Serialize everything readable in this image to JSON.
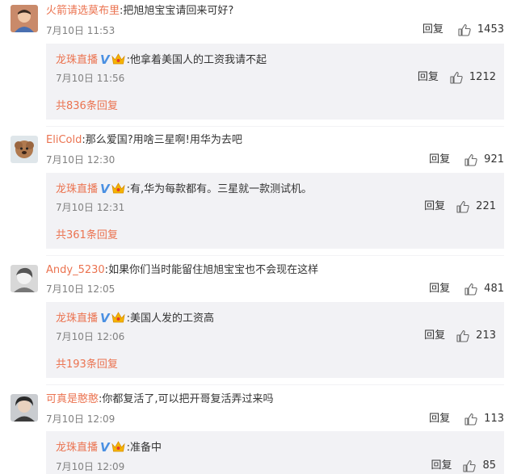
{
  "threads": [
    {
      "user": "火箭请选莫布里",
      "text": "把旭旭宝宝请回来可好?",
      "time": "7月10日 11:53",
      "reply_label": "回复",
      "likes": "1453",
      "sub": {
        "user": "龙珠直播",
        "text": "他拿着美国人的工资我请不起",
        "time": "7月10日 11:56",
        "reply_label": "回复",
        "likes": "1212",
        "total": "共836条回复"
      }
    },
    {
      "user": "EliCold",
      "text": "那么爱国?用啥三星啊!用华为去吧",
      "time": "7月10日 12:30",
      "reply_label": "回复",
      "likes": "921",
      "sub": {
        "user": "龙珠直播",
        "text": "有,华为每款都有。三星就一款测试机。",
        "time": "7月10日 12:31",
        "reply_label": "回复",
        "likes": "221",
        "total": "共361条回复"
      }
    },
    {
      "user": "Andy_5230",
      "text": "如果你们当时能留住旭旭宝宝也不会现在这样",
      "time": "7月10日 12:05",
      "reply_label": "回复",
      "likes": "481",
      "sub": {
        "user": "龙珠直播",
        "text": "美国人发的工资高",
        "time": "7月10日 12:06",
        "reply_label": "回复",
        "likes": "213",
        "total": "共193条回复"
      }
    },
    {
      "user": "可真是憨憨",
      "text": "你都复活了,可以把开哥复活弄过来吗",
      "time": "7月10日 12:09",
      "reply_label": "回复",
      "likes": "113",
      "sub": {
        "user": "龙珠直播",
        "text": "准备中",
        "time": "7月10日 12:09",
        "reply_label": "回复",
        "likes": "85"
      }
    }
  ],
  "icons": {
    "verified": "V",
    "like": "thumbs-up-icon",
    "vip": "crown-icon"
  },
  "colors": {
    "username": "#eb7350",
    "verified": "#4a90e2",
    "subbox_bg": "#f2f2f5",
    "time": "#808080"
  }
}
